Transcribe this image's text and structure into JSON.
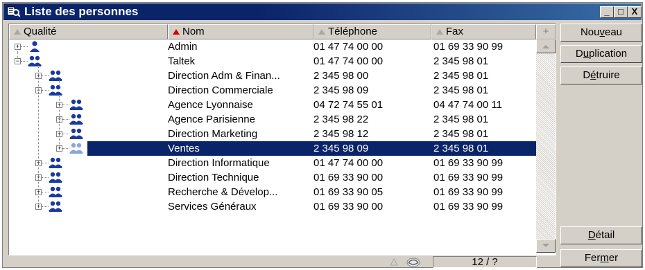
{
  "window": {
    "title": "Liste des personnes",
    "controls": [
      "_",
      "□",
      "X"
    ]
  },
  "columns": [
    {
      "label": "Qualité",
      "sorted": false
    },
    {
      "label": "Nom",
      "sorted": true
    },
    {
      "label": "Téléphone",
      "sorted": false
    },
    {
      "label": "Fax",
      "sorted": false
    }
  ],
  "column_plus": "+",
  "rows": [
    {
      "level": 0,
      "icon": "person-icon",
      "expander": "+",
      "name": "Admin",
      "phone": "01 47 74 00 00",
      "fax": "01 69 33 90 99",
      "selected": false
    },
    {
      "level": 0,
      "icon": "group-icon",
      "expander": "−",
      "name": "Taltek",
      "phone": "01 47 74 00 00",
      "fax": "2 345 98 01",
      "selected": false
    },
    {
      "level": 1,
      "icon": "group-icon",
      "expander": "+",
      "name": "Direction Adm & Finan...",
      "phone": "2 345 98 00",
      "fax": "2 345 98 01",
      "selected": false
    },
    {
      "level": 1,
      "icon": "group-icon",
      "expander": "−",
      "name": "Direction Commerciale",
      "phone": "2 345 98 09",
      "fax": "2 345 98 01",
      "selected": false
    },
    {
      "level": 2,
      "icon": "group-icon",
      "expander": "+",
      "name": "Agence Lyonnaise",
      "phone": "04 72 74 55 01",
      "fax": "04 47 74 00 11",
      "selected": false
    },
    {
      "level": 2,
      "icon": "group-icon",
      "expander": "+",
      "name": "Agence Parisienne",
      "phone": "2 345 98 22",
      "fax": "2 345 98 01",
      "selected": false
    },
    {
      "level": 2,
      "icon": "group-icon",
      "expander": "+",
      "name": "Direction Marketing",
      "phone": "2 345 98 12",
      "fax": "2 345 98 01",
      "selected": false
    },
    {
      "level": 2,
      "icon": "group-icon",
      "expander": "+",
      "name": "Ventes",
      "phone": "2 345 98 09",
      "fax": "2 345 98 01",
      "selected": true
    },
    {
      "level": 1,
      "icon": "group-icon",
      "expander": "+",
      "name": "Direction Informatique",
      "phone": "01 47 74 00 00",
      "fax": "01 69 33 90 99",
      "selected": false
    },
    {
      "level": 1,
      "icon": "group-icon",
      "expander": "+",
      "name": "Direction Technique",
      "phone": "01 69 33 90 00",
      "fax": "01 69 33 90 99",
      "selected": false
    },
    {
      "level": 1,
      "icon": "group-icon",
      "expander": "+",
      "name": "Recherche & Dévelop...",
      "phone": "01 69 33 90 05",
      "fax": "01 69 33 90 99",
      "selected": false
    },
    {
      "level": 1,
      "icon": "group-icon",
      "expander": "+",
      "name": "Services Généraux",
      "phone": "01 69 33 90 00",
      "fax": "01 69 33 90 99",
      "selected": false
    }
  ],
  "status": {
    "count": "12 / ?"
  },
  "buttons": {
    "nouveau": {
      "pre": "Nou",
      "key": "v",
      "post": "eau"
    },
    "duplication": {
      "pre": "D",
      "key": "u",
      "post": "plication"
    },
    "detruire": {
      "pre": "D",
      "key": "é",
      "post": "truire"
    },
    "detail": {
      "pre": "",
      "key": "D",
      "post": "étail"
    },
    "fermer": {
      "pre": "Fer",
      "key": "m",
      "post": "er"
    }
  },
  "colors": {
    "title_bar": "#0a246a",
    "selection": "#0a246a",
    "window_bg": "#d4d0c8",
    "group_icon": "#1a3a9c",
    "person_icon": "#1a3a9c",
    "sort_indicator": "#d40000"
  }
}
